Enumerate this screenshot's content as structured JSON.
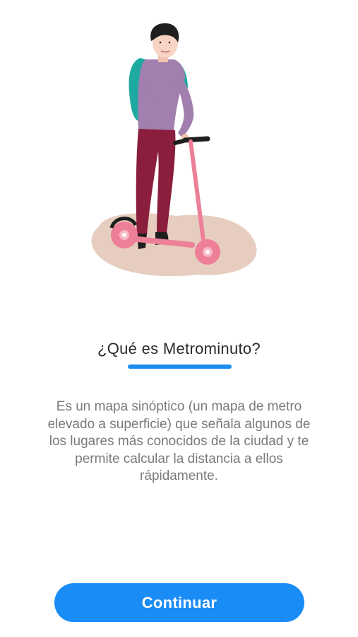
{
  "onboarding": {
    "title": "¿Qué es Metrominuto?",
    "description": "Es un mapa sinóptico (un mapa de metro elevado a superficie) que señala algunos de los lugares más conocidos de la ciudad y te permite calcular la distancia a ellos rápidamente.",
    "continue_label": "Continuar"
  },
  "colors": {
    "accent": "#1a8cf5",
    "title_text": "#2a2a2a",
    "body_text": "#7a7a7a",
    "scooter": "#ee7f98",
    "ground": "#e6cdbf"
  },
  "illustration": {
    "name": "person-on-scooter-illustration"
  }
}
